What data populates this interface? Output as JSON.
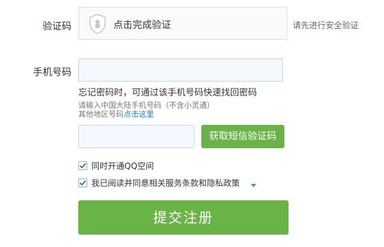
{
  "captcha": {
    "label": "验证码",
    "box_text": "点击完成验证",
    "hint": "请先进行安全验证"
  },
  "phone": {
    "label": "手机号码",
    "value": "",
    "note_main": "忘记密码时，可通过该手机号码快速找回密码",
    "note_small": "请输入中国大陆手机号码（不含小灵通）",
    "note_other_prefix": "其他地区号码",
    "note_other_link": "点击这里"
  },
  "sms": {
    "input_value": "",
    "button_label": "获取短信验证码"
  },
  "options": {
    "qzone_label": "同时开通QQ空间",
    "qzone_checked": true,
    "agreement_label": "我已阅读并同意相关服务条款和隐私政策",
    "agreement_checked": true
  },
  "submit": {
    "label": "提交注册"
  },
  "colors": {
    "accent_green": "#6ab447",
    "link_blue": "#2a7ed4"
  },
  "icons": {
    "captcha": "shield-icon",
    "checkbox": "check-icon",
    "dropdown": "triangle-down-icon"
  }
}
